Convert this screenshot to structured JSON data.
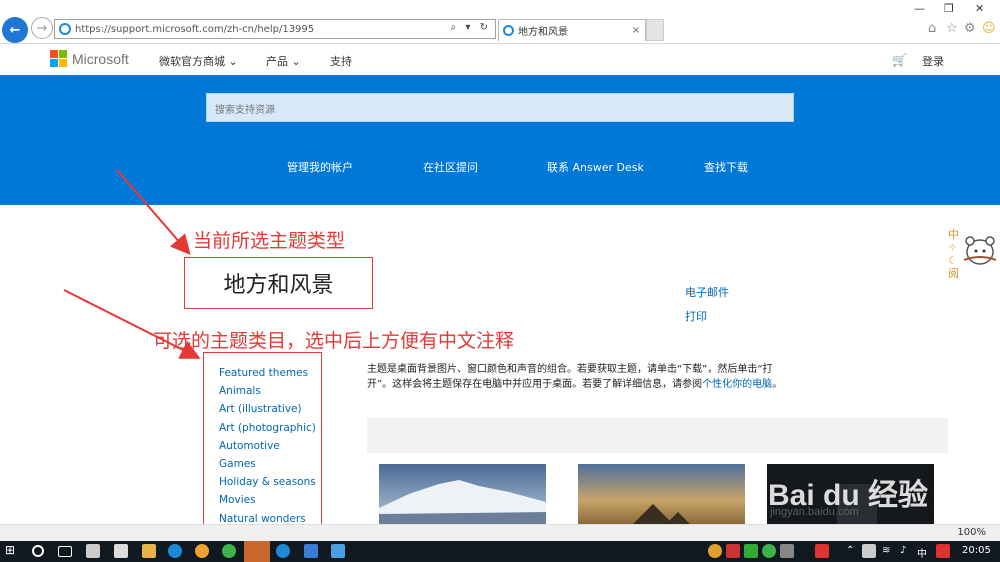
{
  "browser": {
    "url": "https://support.microsoft.com/zh-cn/help/13995",
    "tab_title": "地方和风景",
    "tab_close": "×",
    "zoom": "100%"
  },
  "header": {
    "logo": "Microsoft",
    "nav": [
      "微软官方商城 ⌄",
      "产品 ⌄",
      "支持"
    ],
    "signin": "登录"
  },
  "hero": {
    "search_placeholder": "搜索支持资源",
    "links": [
      "管理我的帐户",
      "在社区提问",
      "联系 Answer Desk",
      "查找下载"
    ]
  },
  "content": {
    "current_theme": "地方和风景",
    "annotation_1": "当前所选主题类型",
    "annotation_2": "可选的主题类目，选中后上方便有中文注释",
    "categories": [
      "Featured themes",
      "Animals",
      "Art (illustrative)",
      "Art (photographic)",
      "Automotive",
      "Games",
      "Holiday & seasons",
      "Movies",
      "Natural wonders"
    ],
    "side_links": [
      "电子邮件",
      "打印"
    ],
    "description": "主题是桌面背景图片、窗口颜色和声音的组合。若要获取主题，请单击“下载”，然后单击“打开”。这样会将主题保存在电脑中并应用于桌面。若要了解详细信息，请参阅",
    "description_link": "个性化你的电脑",
    "description_end": "。"
  },
  "side_widget": [
    "中",
    "阅"
  ],
  "watermark": {
    "logo": "Bai du 经验",
    "url": "jingyan.baidu.com"
  },
  "taskbar": {
    "ime": "中",
    "time": "20:05"
  },
  "colors": {
    "accent": "#0078d7",
    "annotation": "#e53935",
    "link": "#0067b8"
  }
}
